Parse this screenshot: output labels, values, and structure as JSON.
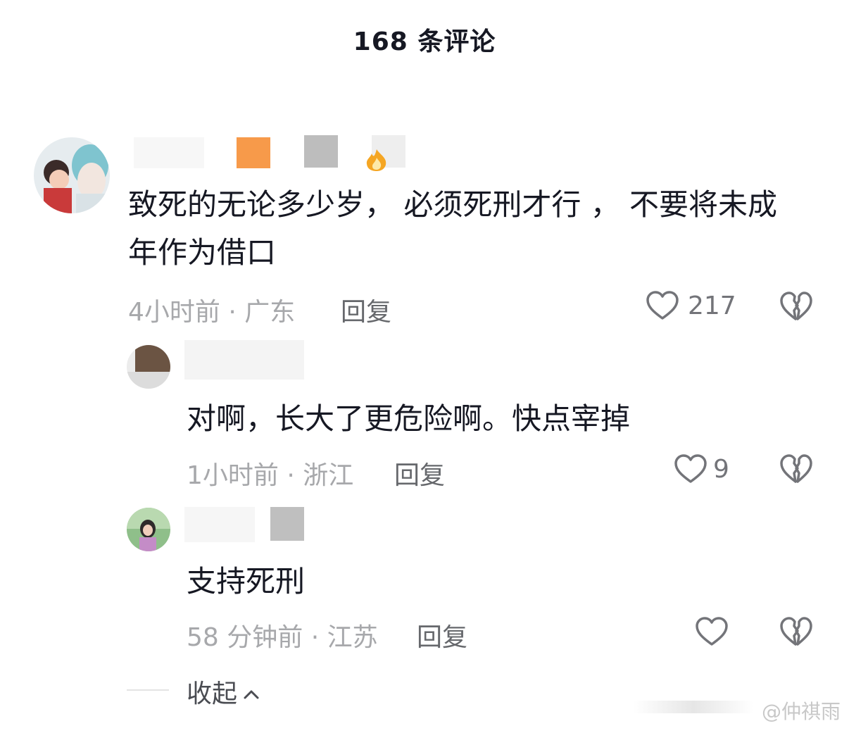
{
  "header": {
    "title": "168 条评论"
  },
  "comments": [
    {
      "content": "致死的无论多少岁， 必须死刑才行 ， 不要将未成年作为借口",
      "time_location": "4小时前 · 广东",
      "reply_label": "回复",
      "like_count": "217"
    },
    {
      "content": "对啊，长大了更危险啊。快点宰掉",
      "time_location": "1小时前 · 浙江",
      "reply_label": "回复",
      "like_count": "9"
    },
    {
      "content": "支持死刑",
      "time_location": "58 分钟前 · 江苏",
      "reply_label": "回复",
      "like_count": ""
    }
  ],
  "footer": {
    "collapse_label": "收起"
  },
  "watermark": {
    "text": "@仲祺雨"
  },
  "colors": {
    "text": "#161823",
    "meta": "#a7a8ab",
    "reply": "#66686c",
    "icon": "#737479"
  }
}
